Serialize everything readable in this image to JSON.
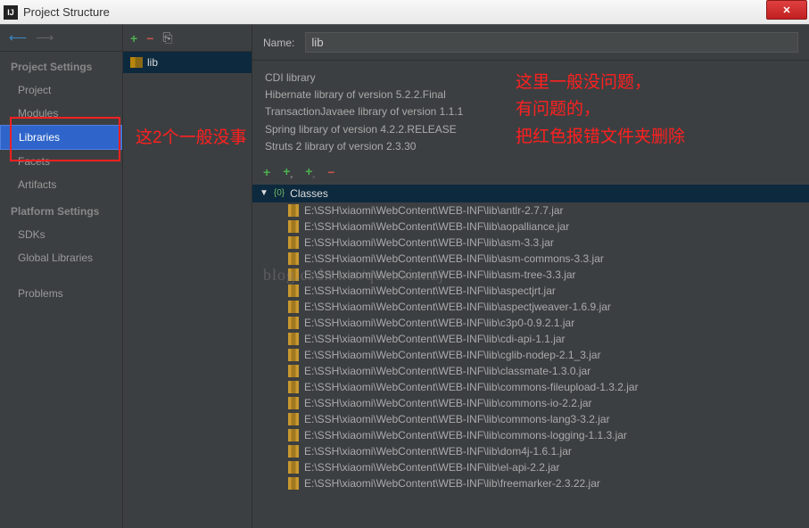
{
  "window": {
    "title": "Project Structure"
  },
  "sidebar": {
    "section1": "Project Settings",
    "items1": [
      "Project",
      "Modules",
      "Libraries",
      "Facets",
      "Artifacts"
    ],
    "selected": "Libraries",
    "section2": "Platform Settings",
    "items2": [
      "SDKs",
      "Global Libraries"
    ],
    "section3": "",
    "items3": [
      "Problems"
    ]
  },
  "libpanel": {
    "item": "lib"
  },
  "content": {
    "name_label": "Name:",
    "name_value": "lib",
    "descriptions": [
      "CDI library",
      "Hibernate library of version 5.2.2.Final",
      "TransactionJavaee library of version 1.1.1",
      "Spring library of version 4.2.2.RELEASE",
      "Struts 2 library of version 2.3.30"
    ],
    "tree_root": "Classes",
    "jars": [
      "E:\\SSH\\xiaomi\\WebContent\\WEB-INF\\lib\\antlr-2.7.7.jar",
      "E:\\SSH\\xiaomi\\WebContent\\WEB-INF\\lib\\aopalliance.jar",
      "E:\\SSH\\xiaomi\\WebContent\\WEB-INF\\lib\\asm-3.3.jar",
      "E:\\SSH\\xiaomi\\WebContent\\WEB-INF\\lib\\asm-commons-3.3.jar",
      "E:\\SSH\\xiaomi\\WebContent\\WEB-INF\\lib\\asm-tree-3.3.jar",
      "E:\\SSH\\xiaomi\\WebContent\\WEB-INF\\lib\\aspectjrt.jar",
      "E:\\SSH\\xiaomi\\WebContent\\WEB-INF\\lib\\aspectjweaver-1.6.9.jar",
      "E:\\SSH\\xiaomi\\WebContent\\WEB-INF\\lib\\c3p0-0.9.2.1.jar",
      "E:\\SSH\\xiaomi\\WebContent\\WEB-INF\\lib\\cdi-api-1.1.jar",
      "E:\\SSH\\xiaomi\\WebContent\\WEB-INF\\lib\\cglib-nodep-2.1_3.jar",
      "E:\\SSH\\xiaomi\\WebContent\\WEB-INF\\lib\\classmate-1.3.0.jar",
      "E:\\SSH\\xiaomi\\WebContent\\WEB-INF\\lib\\commons-fileupload-1.3.2.jar",
      "E:\\SSH\\xiaomi\\WebContent\\WEB-INF\\lib\\commons-io-2.2.jar",
      "E:\\SSH\\xiaomi\\WebContent\\WEB-INF\\lib\\commons-lang3-3.2.jar",
      "E:\\SSH\\xiaomi\\WebContent\\WEB-INF\\lib\\commons-logging-1.1.3.jar",
      "E:\\SSH\\xiaomi\\WebContent\\WEB-INF\\lib\\dom4j-1.6.1.jar",
      "E:\\SSH\\xiaomi\\WebContent\\WEB-INF\\lib\\el-api-2.2.jar",
      "E:\\SSH\\xiaomi\\WebContent\\WEB-INF\\lib\\freemarker-2.3.22.jar"
    ]
  },
  "annotations": {
    "left": "这2个一般没事",
    "right": "这里一般没问题，\n有问题的，\n把红色报错文件夹删除"
  },
  "watermark": "blog.csdn.net/quanaianzj"
}
